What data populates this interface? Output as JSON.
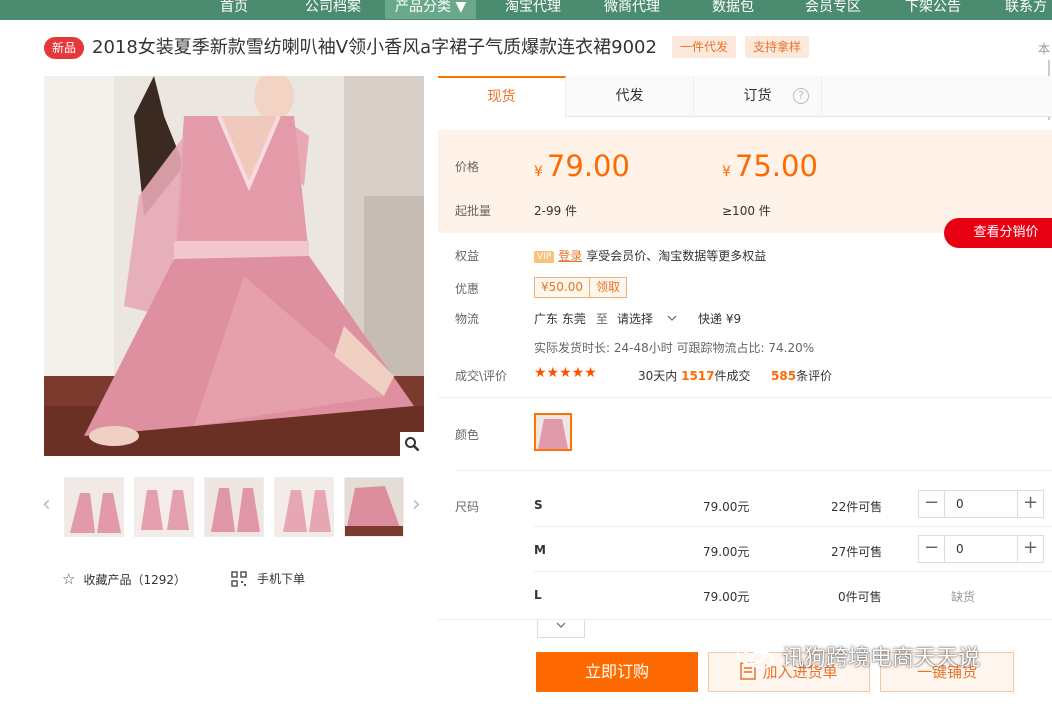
{
  "nav": {
    "items": [
      "首页",
      "公司档案",
      "产品分类 ▼",
      "淘宝代理",
      "微商代理",
      "数据包",
      "会员专区",
      "下架公告",
      "联系方"
    ]
  },
  "product": {
    "badge": "新品",
    "title": "2018女装夏季新款雪纺喇叭袖V领小香风a字裙子气质爆款连衣裙9002",
    "tags": [
      "一件代发",
      "支持拿样"
    ],
    "edge_text": "本"
  },
  "gallery": {
    "collect_label": "收藏产品（1292）",
    "mobile_label": "手机下单"
  },
  "tabs": [
    "现货",
    "代发",
    "订货"
  ],
  "pricing": {
    "price_label": "价格",
    "currency": "¥",
    "price_1": "79.00",
    "price_2": "75.00",
    "moq_label": "起批量",
    "range_1": "2-99 件",
    "range_2": "≥100 件",
    "dist_button": "查看分销价"
  },
  "benefits": {
    "label": "权益",
    "vip": "VIP",
    "login": "登录",
    "text": "享受会员价、淘宝数据等更多权益"
  },
  "coupon": {
    "label": "优惠",
    "amount": "¥50.00",
    "get": "领取"
  },
  "logistics": {
    "label": "物流",
    "from": "广东 东莞",
    "to": "至",
    "select": "请选择",
    "express": "快递 ¥9",
    "detail": "实际发货时长: 24-48小时   可跟踪物流占比: 74.20%"
  },
  "deals": {
    "label": "成交\\评价",
    "stars": "★★★★★",
    "days_prefix": "30天内",
    "count": "1517",
    "count_suffix": "件成交",
    "reviews": "585",
    "reviews_suffix": "条评价"
  },
  "color": {
    "label": "颜色"
  },
  "sizes": {
    "label": "尺码",
    "rows": [
      {
        "name": "S",
        "price": "79.00元",
        "stock": "22件可售",
        "qty": "0"
      },
      {
        "name": "M",
        "price": "79.00元",
        "stock": "27件可售",
        "qty": "0"
      },
      {
        "name": "L",
        "price": "79.00元",
        "stock": "0件可售",
        "status": "缺货"
      }
    ]
  },
  "actions": {
    "order": "立即订购",
    "cart": "加入进货单",
    "dist": "一键铺货"
  },
  "watermark": {
    "text": "讯狗跨境电商天天说"
  },
  "colors": {
    "nav_bg": "#4b8c70",
    "accent": "#ff6a00",
    "red": "#e60012"
  }
}
